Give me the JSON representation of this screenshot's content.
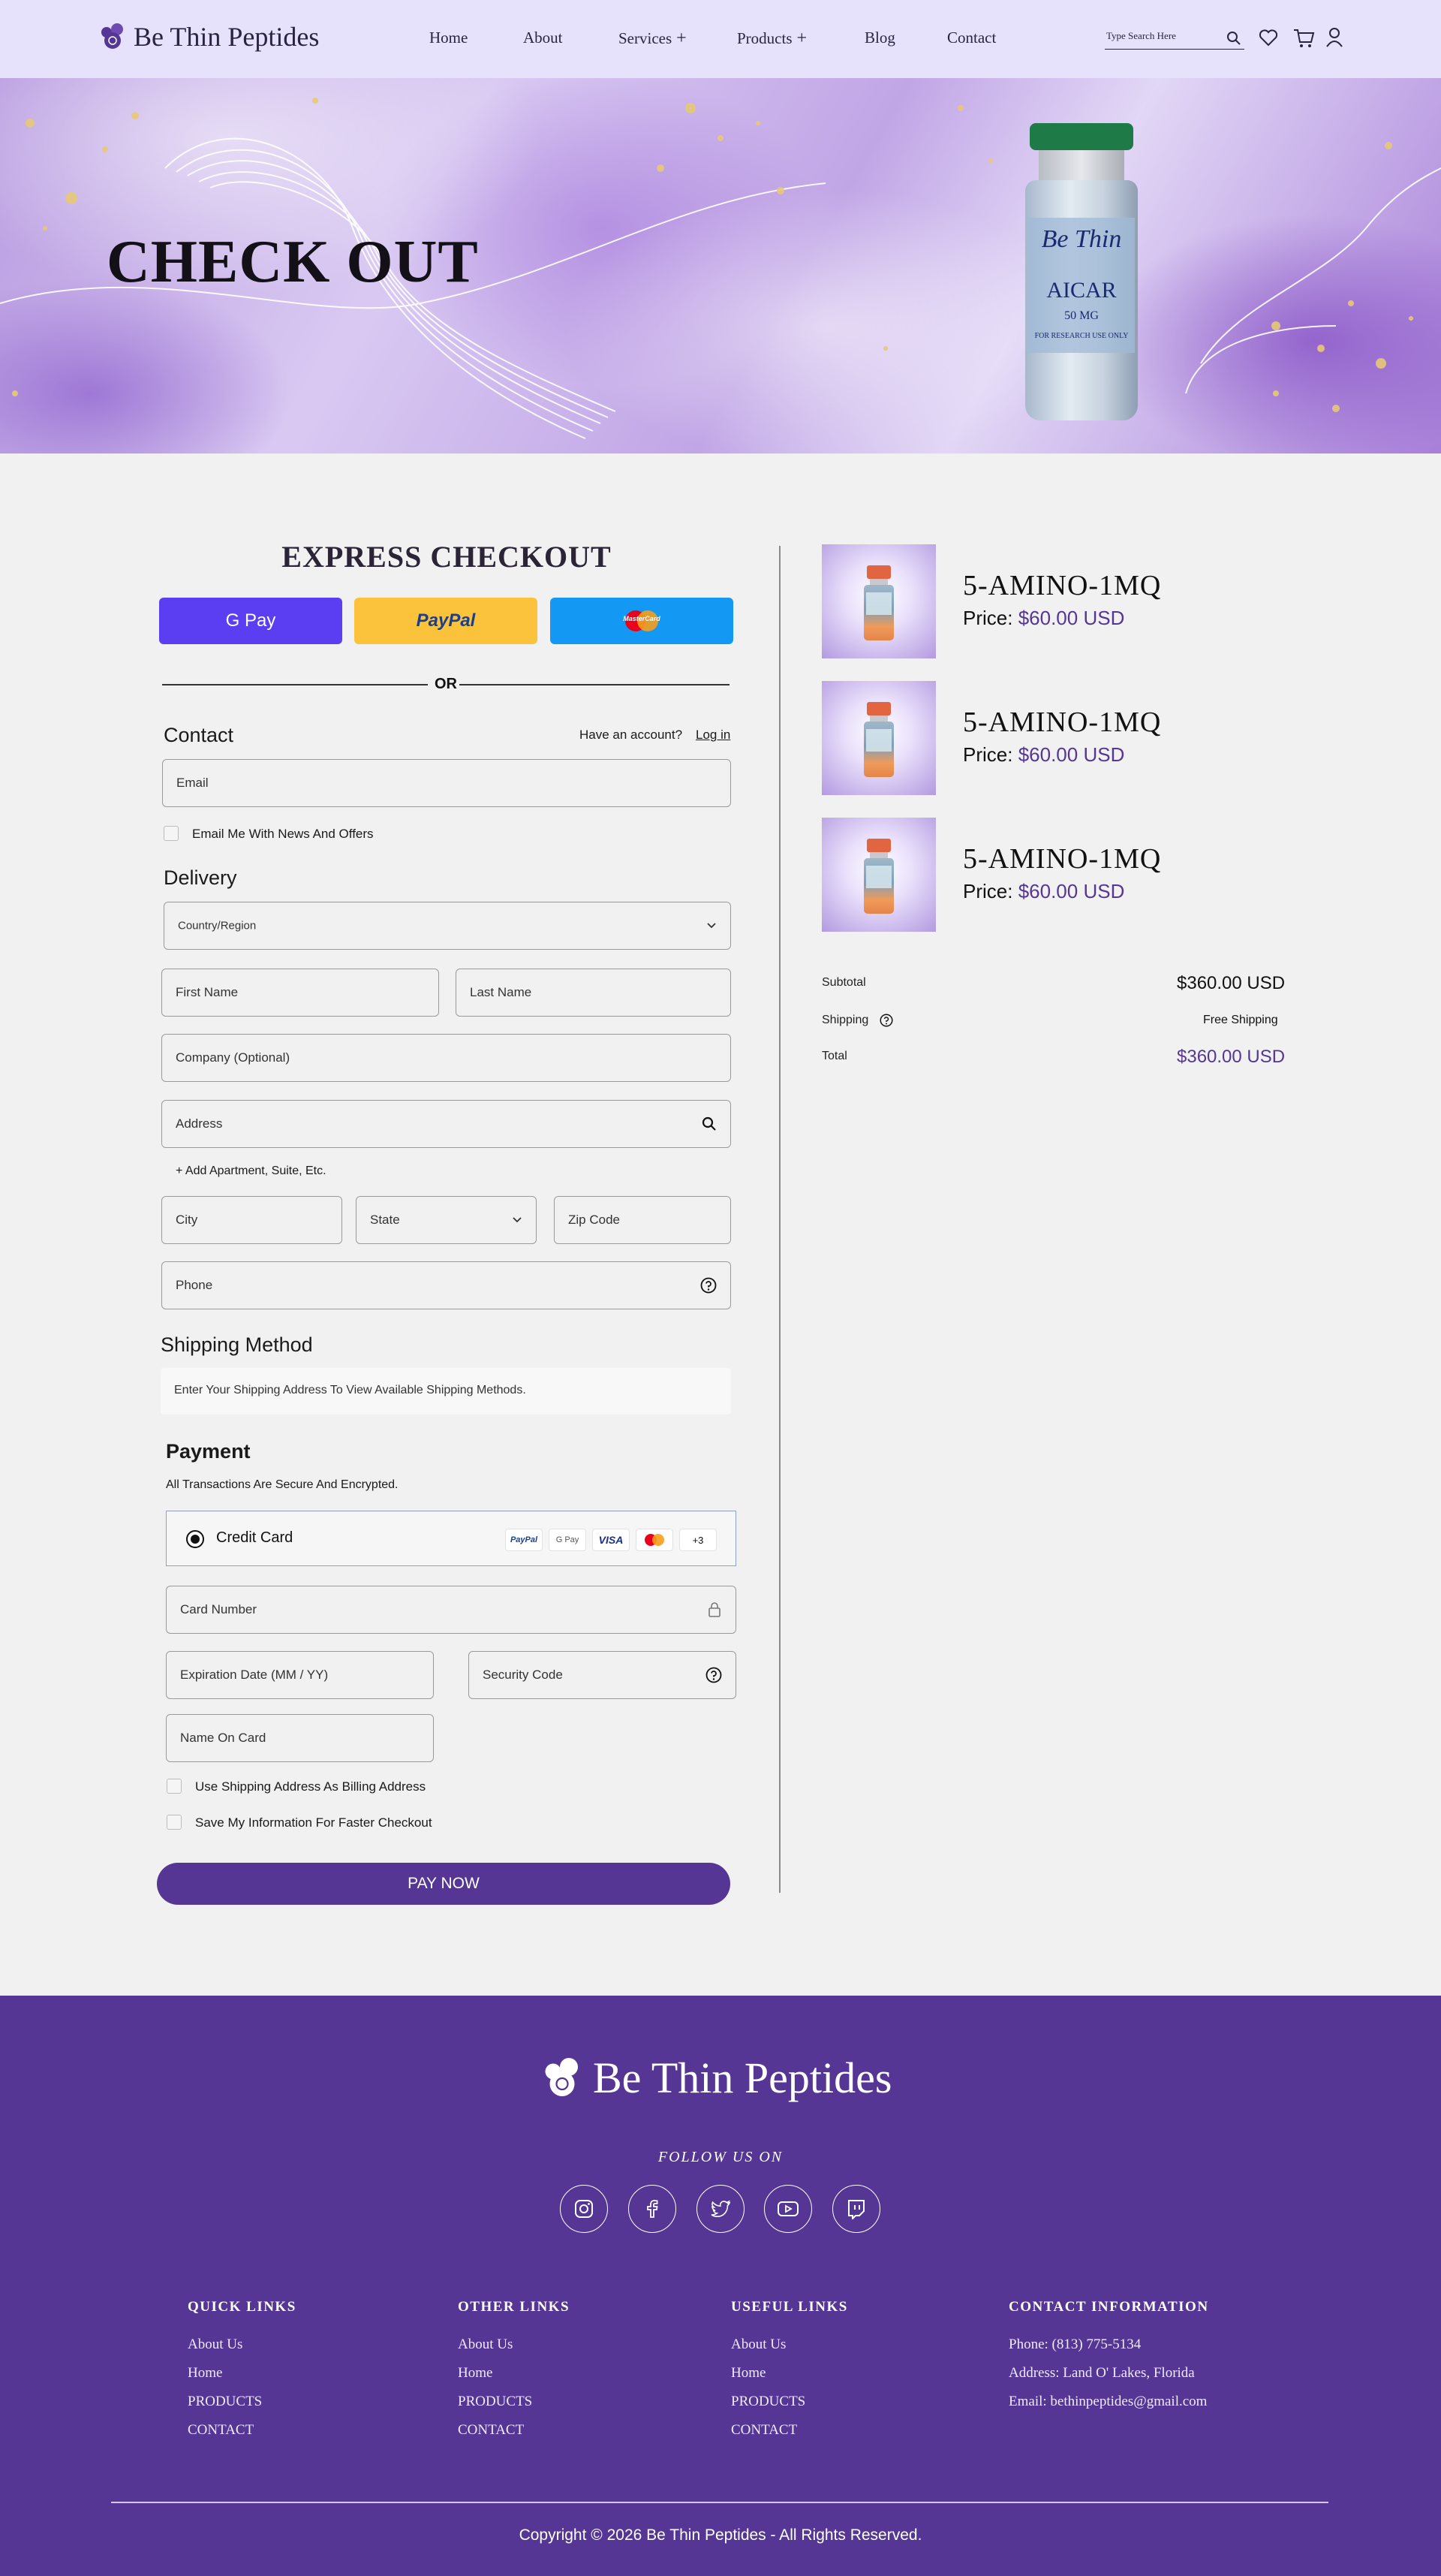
{
  "header": {
    "brand": "Be Thin Peptides",
    "nav": [
      {
        "label": "Home"
      },
      {
        "label": "About"
      },
      {
        "label": "Services",
        "expand": "+"
      },
      {
        "label": "Products",
        "expand": "+"
      },
      {
        "label": "Blog"
      },
      {
        "label": "Contact"
      }
    ],
    "search_placeholder": "Type Search Here",
    "icons": [
      "search-icon",
      "heart-icon",
      "cart-icon",
      "user-icon"
    ]
  },
  "hero": {
    "title": "CHECK OUT",
    "vial_brand": "Be Thin",
    "vial_name": "AICAR",
    "vial_dose": "50 MG",
    "vial_note": "FOR RESEARCH USE ONLY"
  },
  "checkout": {
    "express_title": "EXPRESS CHECKOUT",
    "express_buttons": [
      "G Pay",
      "PayPal",
      "MasterCard"
    ],
    "or_text": "OR",
    "contact_title": "Contact",
    "have_account": "Have an account?",
    "login_link": "Log in",
    "email_placeholder": "Email",
    "email_offers": "Email Me With News And Offers",
    "delivery_title": "Delivery",
    "country_placeholder": "Country/Region",
    "first_name": "First Name",
    "last_name": "Last Name",
    "company": "Company (Optional)",
    "address": "Address",
    "add_apartment": "+ Add Apartment, Suite, Etc.",
    "city": "City",
    "state": "State",
    "zip": "Zip Code",
    "phone": "Phone",
    "shipping_method_title": "Shipping Method",
    "shipping_method_note": "Enter Your Shipping Address To View Available Shipping Methods.",
    "payment_title": "Payment",
    "payment_note": "All Transactions Are Secure And Encrypted.",
    "credit_card_label": "Credit Card",
    "card_brands": [
      "PayPal",
      "G Pay",
      "VISA",
      "MC",
      "+3"
    ],
    "card_number": "Card Number",
    "expiration": "Expiration Date (MM / YY)",
    "security_code": "Security Code",
    "name_on_card": "Name On Card",
    "use_shipping_billing": "Use Shipping Address As Billing Address",
    "save_info": "Save My Information For Faster Checkout",
    "pay_now": "PAY NOW"
  },
  "cart": {
    "items": [
      {
        "name": "5-AMINO-1MQ",
        "price_label": "Price:",
        "price": "$60.00 USD"
      },
      {
        "name": "5-AMINO-1MQ",
        "price_label": "Price:",
        "price": "$60.00 USD"
      },
      {
        "name": "5-AMINO-1MQ",
        "price_label": "Price:",
        "price": "$60.00 USD"
      }
    ],
    "subtotal_label": "Subtotal",
    "subtotal": "$360.00 USD",
    "shipping_label": "Shipping",
    "shipping": "Free Shipping",
    "total_label": "Total",
    "total": "$360.00 USD"
  },
  "footer": {
    "brand": "Be Thin Peptides",
    "follow": "FOLLOW US ON",
    "socials": [
      "instagram-icon",
      "facebook-icon",
      "twitter-icon",
      "youtube-icon",
      "twitch-icon"
    ],
    "quick_links_title": "QUICK LINKS",
    "quick_links": [
      "About Us",
      "Home",
      "PRODUCTS",
      "CONTACT"
    ],
    "other_links_title": "OTHER LINKS",
    "other_links": [
      "About Us",
      "Home",
      "PRODUCTS",
      "CONTACT"
    ],
    "useful_links_title": "USEFUL LINKS",
    "useful_links": [
      "About Us",
      "Home",
      "PRODUCTS",
      "CONTACT"
    ],
    "contact_title": "CONTACT INFORMATION",
    "contact_phone": "Phone: (813) 775-5134",
    "contact_address": "Address: Land O' Lakes, Florida",
    "contact_email": "Email: bethinpeptides@gmail.com",
    "copyright": "Copyright © 2026 Be Thin Peptides - All Rights Reserved."
  },
  "colors": {
    "header_bg": "#e7e2fb",
    "brand_purple": "#553694",
    "gpay_btn": "#5b3df2",
    "paypal_btn": "#fbc33b",
    "mastercard_btn": "#1398f3",
    "page_bg": "#f1f1f1"
  }
}
